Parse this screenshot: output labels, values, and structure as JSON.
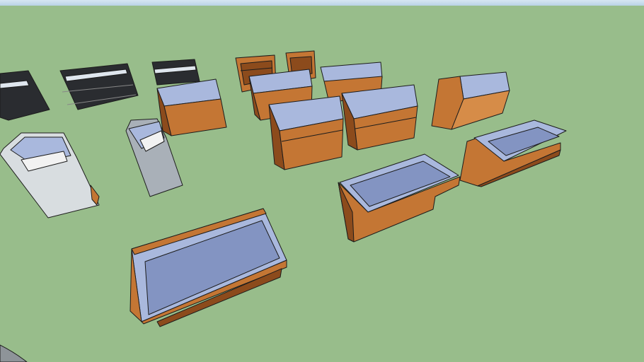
{
  "scene": {
    "title": "",
    "colors": {
      "sky": "#c9dcec",
      "ground": "#98bd8b",
      "wood": "#c47634",
      "wood_dark": "#8c4b1c",
      "wood_light": "#d68c48",
      "glass": "#a9b8dd",
      "glass_dark": "#8394c2",
      "black": "#2a2c30",
      "white_case": "#d8dde0",
      "edge": "#1c1c1c"
    }
  }
}
